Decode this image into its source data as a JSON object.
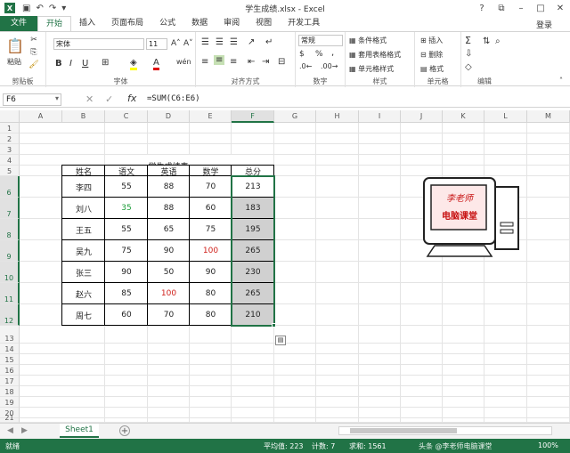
{
  "window": {
    "title": "学生成绩.xlsx - Excel",
    "login": "登录"
  },
  "tabs": [
    "文件",
    "开始",
    "插入",
    "页面布局",
    "公式",
    "数据",
    "审阅",
    "视图",
    "开发工具"
  ],
  "ribbon": {
    "clipboard": {
      "label": "剪贴板",
      "paste": "粘贴"
    },
    "font": {
      "label": "字体",
      "name": "宋体",
      "size": "11",
      "bold": "B",
      "italic": "I",
      "underline": "U"
    },
    "alignment": {
      "label": "对齐方式"
    },
    "number": {
      "label": "数字",
      "format": "常规",
      "percent": "%",
      "comma": ","
    },
    "styles": {
      "label": "样式",
      "conditional": "条件格式",
      "table": "套用表格格式",
      "cell": "单元格样式"
    },
    "cells": {
      "label": "单元格",
      "insert": "插入",
      "delete": "删除",
      "format": "格式"
    },
    "editing": {
      "label": "编辑"
    }
  },
  "formula_bar": {
    "name_box": "F6",
    "formula": "=SUM(C6:E6)"
  },
  "columns": [
    "A",
    "B",
    "C",
    "D",
    "E",
    "F",
    "G",
    "H",
    "I",
    "J",
    "K",
    "L",
    "M"
  ],
  "rows": [
    "1",
    "2",
    "3",
    "4",
    "5",
    "6",
    "7",
    "8",
    "9",
    "10",
    "11",
    "12",
    "13",
    "14",
    "15",
    "16",
    "17",
    "18",
    "19",
    "20",
    "21"
  ],
  "sheet": {
    "title": "学生成绩表",
    "headers": [
      "姓名",
      "语文",
      "英语",
      "数学",
      "总分"
    ],
    "rows": [
      [
        "李四",
        "55",
        "88",
        "70",
        "213"
      ],
      [
        "刘八",
        "35",
        "88",
        "60",
        "183"
      ],
      [
        "王五",
        "55",
        "65",
        "75",
        "195"
      ],
      [
        "吴九",
        "75",
        "90",
        "100",
        "265"
      ],
      [
        "张三",
        "90",
        "50",
        "90",
        "230"
      ],
      [
        "赵六",
        "85",
        "100",
        "80",
        "265"
      ],
      [
        "周七",
        "60",
        "70",
        "80",
        "210"
      ]
    ],
    "highlight": {
      "green": "#1e9e3a",
      "red": "#d0201a"
    }
  },
  "logo": {
    "line1": "李老师",
    "line2": "电脑课堂"
  },
  "sheet_tabs": {
    "active": "Sheet1",
    "add": "+"
  },
  "status": {
    "mode": "就绪",
    "average": "平均值: 223",
    "count": "计数: 7",
    "sum": "求和: 1561",
    "zoom": "100%",
    "watermark": "头条 @李老师电脑课堂"
  },
  "colors": {
    "accent": "#217346"
  }
}
